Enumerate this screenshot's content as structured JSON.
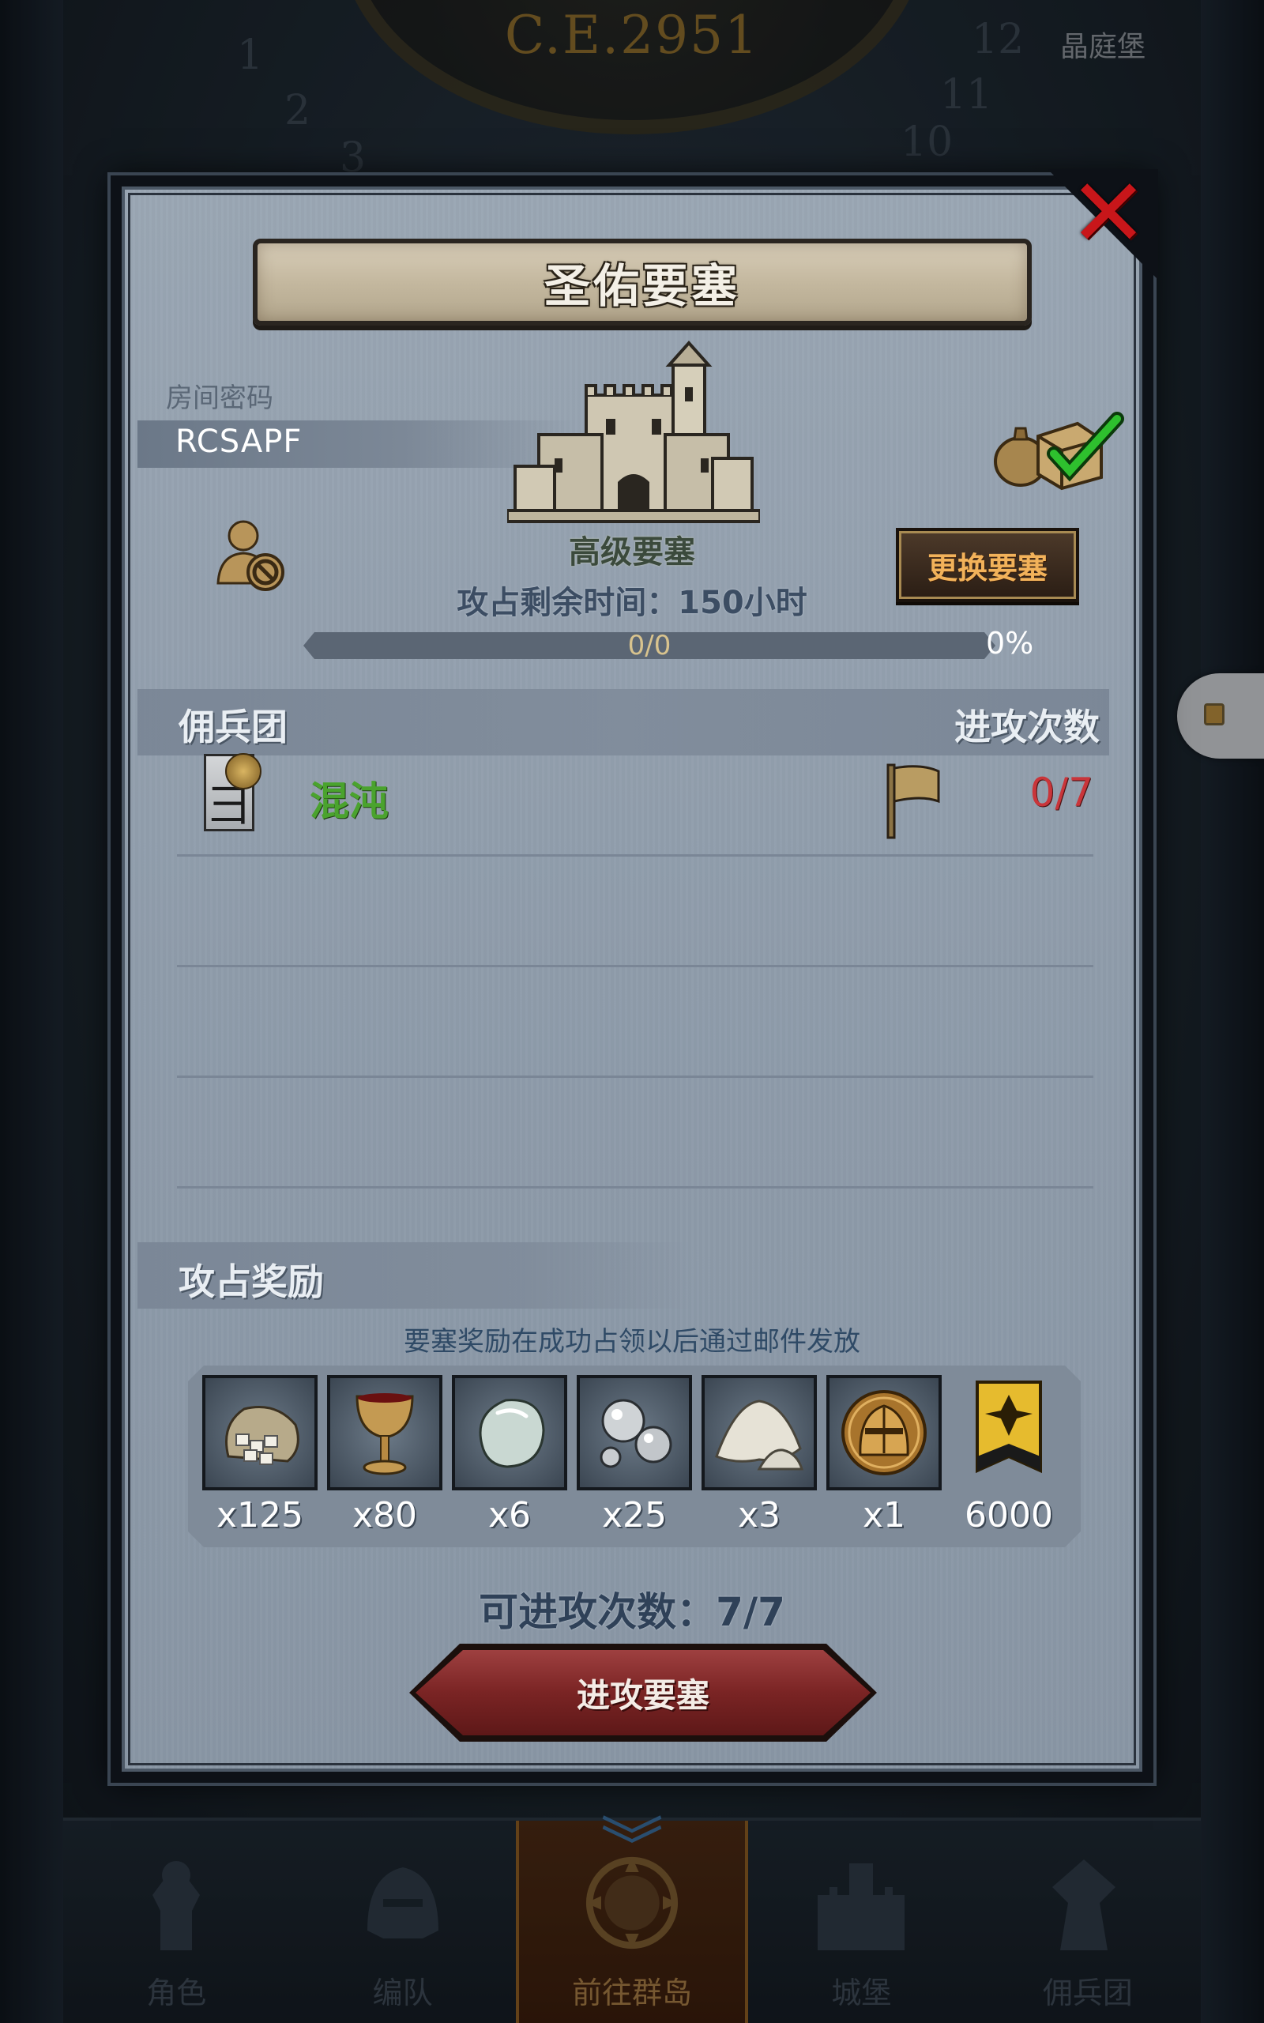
{
  "background": {
    "year": "C.E.2951",
    "place": "晶庭堡",
    "dial_numbers": [
      "1",
      "2",
      "3",
      "12",
      "10",
      "11"
    ]
  },
  "dialog": {
    "title": "圣佑要塞",
    "room_password_label": "房间密码",
    "room_password": "RCSAPF",
    "fortress_grade": "高级要塞",
    "change_button": "更换要塞",
    "time_left": "攻占剩余时间：150小时",
    "progress": {
      "text": "0/0",
      "percent_label": "0%",
      "fraction": 0
    },
    "mercenary_header": "佣兵团",
    "attack_count_header": "进攻次数",
    "mercenaries": [
      {
        "name": "混沌",
        "attacks": "0/7"
      }
    ],
    "reward_header": "攻占奖励",
    "reward_note": "要塞奖励在成功占领以后通过邮件发放",
    "rewards": [
      {
        "icon": "sugar-sack-icon",
        "qty": "x125"
      },
      {
        "icon": "goblet-icon",
        "qty": "x80"
      },
      {
        "icon": "moonstone-icon",
        "qty": "x6"
      },
      {
        "icon": "silver-orbs-icon",
        "qty": "x25"
      },
      {
        "icon": "salt-pile-icon",
        "qty": "x3"
      },
      {
        "icon": "knight-helmet-icon",
        "qty": "x1"
      },
      {
        "icon": "guild-banner-icon",
        "qty": "6000"
      }
    ],
    "attacks_available": "可进攻次数：7/7",
    "attack_button": "进攻要塞"
  },
  "bottom_nav": [
    {
      "label": "角色",
      "icon": "knight-icon",
      "active": false
    },
    {
      "label": "编队",
      "icon": "helmet-icon",
      "active": false
    },
    {
      "label": "前往群岛",
      "icon": "compass-icon",
      "active": true
    },
    {
      "label": "城堡",
      "icon": "castle-icon",
      "active": false
    },
    {
      "label": "佣兵团",
      "icon": "mercenary-icon",
      "active": false
    }
  ],
  "colors": {
    "dialog_bg": "#8f9cab",
    "merc_name": "#4aa32e",
    "attack_count": "#c9353a",
    "change_button_text": "#f2b25a",
    "close": "#c8161a",
    "attack_button": "#7a2424"
  }
}
